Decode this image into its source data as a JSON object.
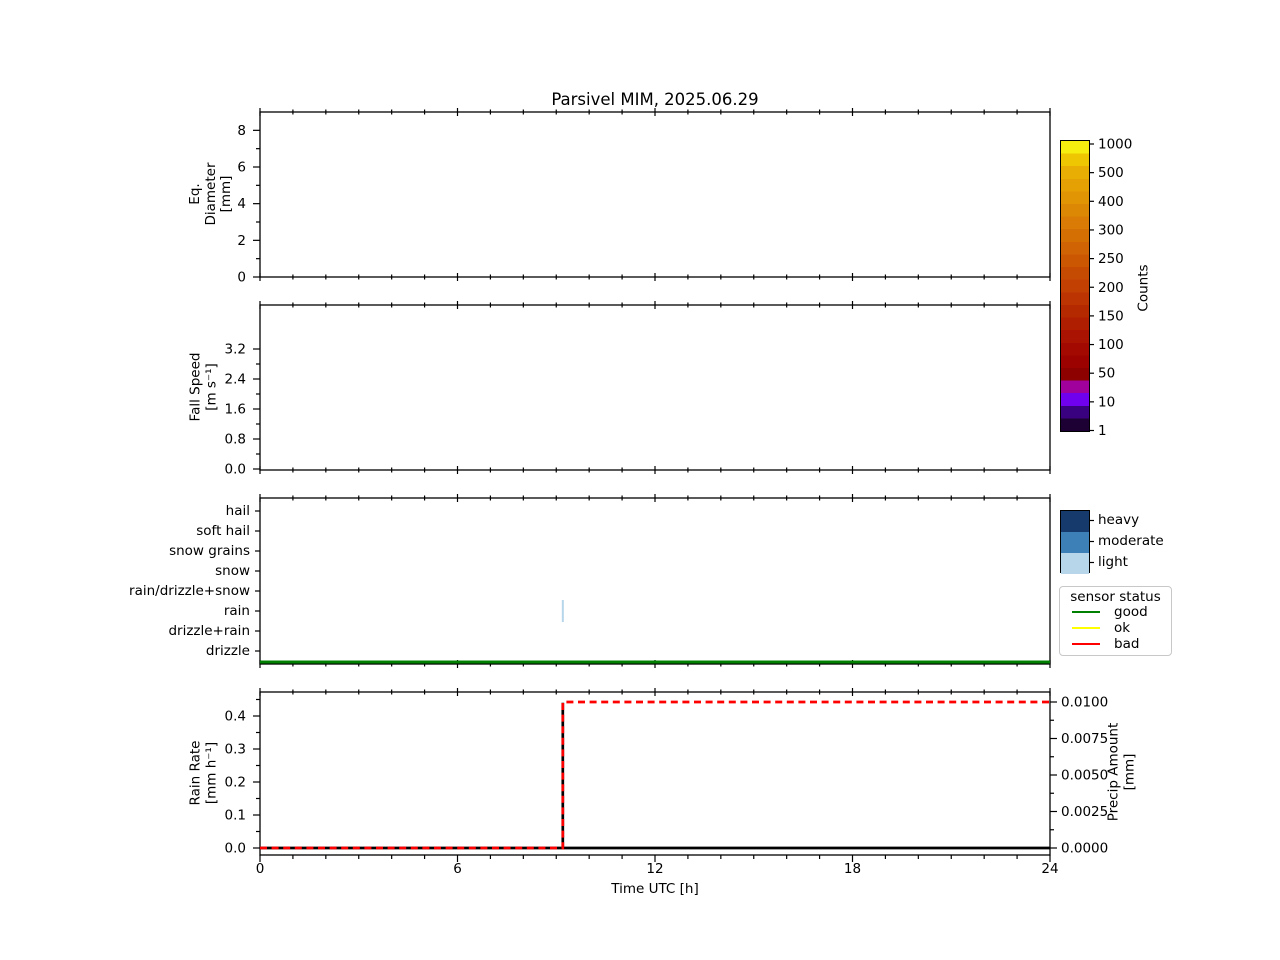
{
  "title": "Parsivel MIM, 2025.06.29",
  "xlabel": "Time UTC [h]",
  "x_axis": {
    "lim": [
      0,
      24
    ],
    "major_ticks": [
      0,
      6,
      12,
      18,
      24
    ],
    "major_tick_labels": [
      "0",
      "6",
      "12",
      "18",
      "24"
    ],
    "minor_tick_step_h": 1
  },
  "chart_data": [
    {
      "panel": "eq_diameter",
      "type": "heatmap",
      "ylabel_lines": [
        "Eq.",
        "Diameter",
        "[mm]"
      ],
      "ylim": [
        0,
        9
      ],
      "yticks": [
        0,
        2,
        4,
        6,
        8
      ],
      "ytick_labels": [
        "0",
        "2",
        "4",
        "6",
        "8"
      ],
      "yminor_ticks": [
        1,
        3,
        5,
        7
      ],
      "values": []
    },
    {
      "panel": "fall_speed",
      "type": "heatmap",
      "ylabel_lines": [
        "Fall Speed",
        "[m s⁻¹]"
      ],
      "ylim": [
        0,
        3.5
      ],
      "yticks": [
        0.0,
        0.8,
        1.6,
        2.4,
        3.2
      ],
      "ytick_labels": [
        "0.0",
        "0.8",
        "1.6",
        "2.4",
        "3.2"
      ],
      "yminor_ticks": [
        0.4,
        1.2,
        2.0,
        2.8
      ],
      "values": []
    },
    {
      "panel": "precip_type",
      "type": "category-timeline",
      "categories": [
        "hail",
        "soft hail",
        "snow grains",
        "snow",
        "rain/drizzle+snow",
        "rain",
        "drizzle+rain",
        "drizzle"
      ],
      "events": [
        {
          "time_h": 9.2,
          "category": "rain",
          "intensity": "light"
        }
      ],
      "sensor_status_line": {
        "status": "good",
        "start_h": 0,
        "end_h": 24
      }
    },
    {
      "panel": "rain_rate",
      "type": "line",
      "left_axis": {
        "label_lines": [
          "Rain Rate",
          "[mm h⁻¹]"
        ],
        "ticks": [
          0.0,
          0.1,
          0.2,
          0.3,
          0.4
        ],
        "tick_labels": [
          "0.0",
          "0.1",
          "0.2",
          "0.3",
          "0.4"
        ],
        "minor_ticks": [
          0.05,
          0.15,
          0.25,
          0.35,
          0.45
        ]
      },
      "right_axis": {
        "label_lines": [
          "Precip Amount",
          "[mm]"
        ],
        "ticks": [
          0.0,
          0.0025,
          0.005,
          0.0075,
          0.01
        ],
        "tick_labels": [
          "0.0000",
          "0.0025",
          "0.0050",
          "0.0075",
          "0.0100"
        ],
        "minor_ticks": [
          0.00125,
          0.00375,
          0.00625,
          0.00875
        ]
      },
      "series": [
        {
          "name": "rain rate",
          "axis": "left",
          "color": "#000000",
          "style": "solid",
          "points": [
            [
              0,
              0
            ],
            [
              9.2,
              0
            ],
            [
              9.2,
              0.44
            ],
            [
              9.2,
              0
            ],
            [
              24,
              0
            ]
          ]
        },
        {
          "name": "precip amount",
          "axis": "right",
          "color": "#ff0000",
          "style": "dashed",
          "points": [
            [
              0,
              0
            ],
            [
              9.2,
              0
            ],
            [
              9.2,
              0.01
            ],
            [
              24,
              0.01
            ]
          ]
        }
      ]
    }
  ],
  "colorbar": {
    "label": "Counts",
    "tick_labels": [
      "1000",
      "500",
      "400",
      "300",
      "250",
      "200",
      "150",
      "100",
      "50",
      "10",
      "1"
    ],
    "colors_top_to_bottom": [
      "#f5ee0f",
      "#eec702",
      "#e9ae03",
      "#e5a104",
      "#e19404",
      "#dd8804",
      "#d97b04",
      "#d46f03",
      "#d06303",
      "#cb5703",
      "#c64b02",
      "#c14002",
      "#bb3402",
      "#b52901",
      "#b01e01",
      "#aa1301",
      "#a30900",
      "#9c0200",
      "#8d0101",
      "#a0019c",
      "#6f01ee",
      "#390180",
      "#1e0134"
    ]
  },
  "intensity_legend": {
    "items": [
      {
        "label": "heavy",
        "color": "#173a6d"
      },
      {
        "label": "moderate",
        "color": "#3d80b8"
      },
      {
        "label": "light",
        "color": "#b8d6ea"
      }
    ]
  },
  "status_legend": {
    "title": "sensor status",
    "items": [
      {
        "label": "good",
        "color": "#008000"
      },
      {
        "label": "ok",
        "color": "#ffff00"
      },
      {
        "label": "bad",
        "color": "#ff0000"
      }
    ]
  }
}
